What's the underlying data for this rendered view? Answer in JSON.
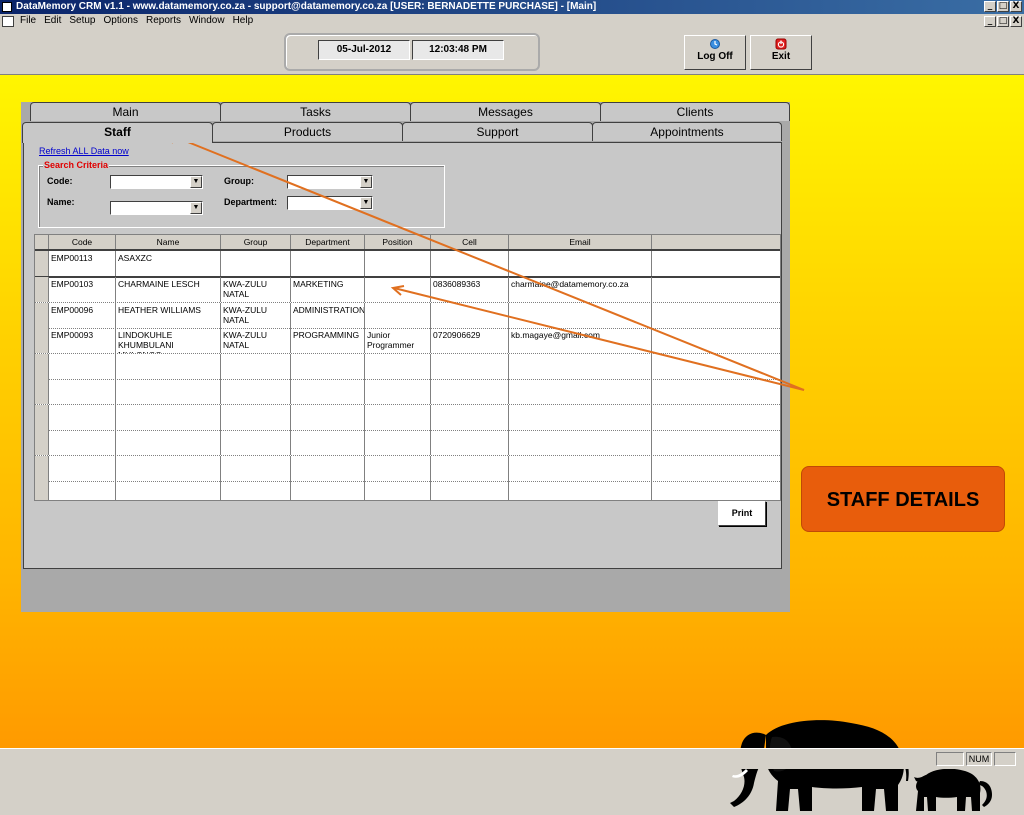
{
  "window": {
    "title": "DataMemory CRM v1.1 - www.datamemory.co.za - support@datamemory.co.za [USER: BERNADETTE PURCHASE] - [Main]",
    "minimize": "_",
    "maximize": "□",
    "close": "X"
  },
  "menu": [
    "File",
    "Edit",
    "Setup",
    "Options",
    "Reports",
    "Window",
    "Help"
  ],
  "toolbar": {
    "date": "05-Jul-2012",
    "time": "12:03:48 PM",
    "logoff_label": "Log Off",
    "exit_label": "Exit"
  },
  "tabs": {
    "row1": [
      "Main",
      "Tasks",
      "Messages",
      "Clients"
    ],
    "row2": [
      "Staff",
      "Products",
      "Support",
      "Appointments"
    ],
    "active": "Staff"
  },
  "staff": {
    "refresh_link": "Refresh ALL Data now",
    "search_criteria": "Search Criteria",
    "code_label": "Code:",
    "group_label": "Group:",
    "name_label": "Name:",
    "department_label": "Department:",
    "columns": [
      "Code",
      "Name",
      "Group",
      "Department",
      "Position",
      "Cell",
      "Email"
    ],
    "rows": [
      [
        "EMP00113",
        "ASAXZC",
        "",
        "",
        "",
        "",
        ""
      ],
      [
        "EMP00103",
        "CHARMAINE LESCH",
        "KWA-ZULU NATAL",
        "MARKETING",
        "",
        "0836089363",
        "charmaine@datamemory.co.za"
      ],
      [
        "EMP00096",
        "HEATHER WILLIAMS",
        "KWA-ZULU NATAL",
        "ADMINISTRATION",
        "",
        "",
        ""
      ],
      [
        "EMP00093",
        "LINDOKUHLE KHUMBULANI MHLONGO",
        "KWA-ZULU NATAL",
        "PROGRAMMING",
        "Junior Programmer",
        "0720906629",
        "kb.magaye@gmail.com"
      ]
    ],
    "print_label": "Print"
  },
  "callout": {
    "text": "STAFF DETAILS",
    "color": "#e85d0c"
  },
  "status": {
    "num": "NUM"
  },
  "colors": {
    "title_bar": "#0a246a",
    "background_top": "#fff600",
    "background_bottom": "#ff9a00",
    "arrow": "#e07020"
  }
}
